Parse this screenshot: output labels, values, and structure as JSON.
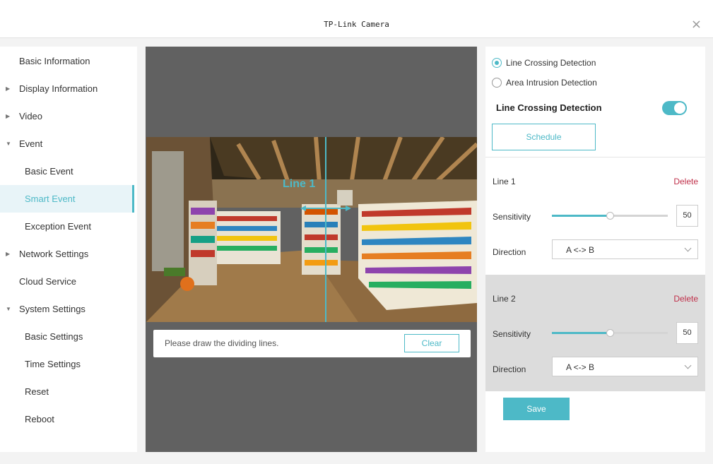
{
  "window": {
    "title": "TP-Link Camera",
    "close_glyph": "×"
  },
  "sidebar": {
    "items": [
      {
        "label": "Basic Information",
        "level": 0,
        "expandable": false,
        "expanded": false,
        "active": false
      },
      {
        "label": "Display Information",
        "level": 0,
        "expandable": true,
        "expanded": false,
        "active": false
      },
      {
        "label": "Video",
        "level": 0,
        "expandable": true,
        "expanded": false,
        "active": false
      },
      {
        "label": "Event",
        "level": 0,
        "expandable": true,
        "expanded": true,
        "active": false
      },
      {
        "label": "Basic Event",
        "level": 1,
        "expandable": false,
        "expanded": false,
        "active": false
      },
      {
        "label": "Smart Event",
        "level": 1,
        "expandable": false,
        "expanded": false,
        "active": true
      },
      {
        "label": "Exception Event",
        "level": 1,
        "expandable": false,
        "expanded": false,
        "active": false
      },
      {
        "label": "Network Settings",
        "level": 0,
        "expandable": true,
        "expanded": false,
        "active": false
      },
      {
        "label": "Cloud Service",
        "level": 0,
        "expandable": false,
        "expanded": false,
        "active": false
      },
      {
        "label": "System Settings",
        "level": 0,
        "expandable": true,
        "expanded": true,
        "active": false
      },
      {
        "label": "Basic Settings",
        "level": 1,
        "expandable": false,
        "expanded": false,
        "active": false
      },
      {
        "label": "Time Settings",
        "level": 1,
        "expandable": false,
        "expanded": false,
        "active": false
      },
      {
        "label": "Reset",
        "level": 1,
        "expandable": false,
        "expanded": false,
        "active": false
      },
      {
        "label": "Reboot",
        "level": 1,
        "expandable": false,
        "expanded": false,
        "active": false
      }
    ]
  },
  "preview": {
    "line_label": "Line 1",
    "hint": "Please draw the dividing lines.",
    "clear_label": "Clear"
  },
  "panel": {
    "modes": [
      {
        "label": "Line Crossing Detection",
        "selected": true
      },
      {
        "label": "Area Intrusion Detection",
        "selected": false
      }
    ],
    "detection_title": "Line Crossing Detection",
    "detection_enabled": true,
    "schedule_label": "Schedule",
    "lines": [
      {
        "name": "Line 1",
        "delete_label": "Delete",
        "sensitivity_label": "Sensitivity",
        "sensitivity": 50,
        "sensitivity_max": 100,
        "direction_label": "Direction",
        "direction": "A <-> B"
      },
      {
        "name": "Line 2",
        "delete_label": "Delete",
        "sensitivity_label": "Sensitivity",
        "sensitivity": 50,
        "sensitivity_max": 100,
        "direction_label": "Direction",
        "direction": "A <-> B"
      }
    ],
    "save_label": "Save"
  },
  "colors": {
    "accent": "#4db9c7",
    "delete": "#c0304a",
    "canvas": "#616161"
  }
}
